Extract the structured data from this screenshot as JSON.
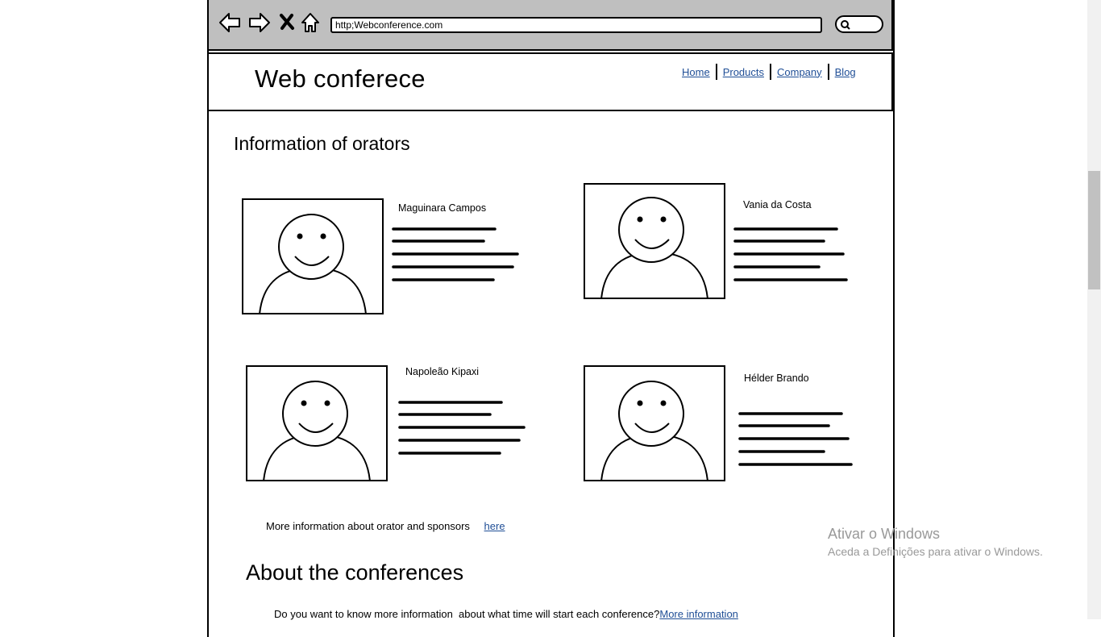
{
  "browser": {
    "url": "http;Webconference.com"
  },
  "site": {
    "title": "Web conferece",
    "nav": [
      "Home",
      "Products",
      "Company",
      "Blog"
    ]
  },
  "orators_section": {
    "title": "Information of orators",
    "orators": [
      {
        "name": "Maguinara Campos"
      },
      {
        "name": "Vania da Costa"
      },
      {
        "name": "Napoleão Kipaxi"
      },
      {
        "name": "Hélder Brando"
      }
    ],
    "more_text": "More information about orator and sponsors",
    "more_link": "here"
  },
  "about_section": {
    "title": "About the conferences",
    "text": "Do you want to know more information  about what time will start each conference?",
    "link": "More information"
  },
  "watermark": {
    "line1": "Ativar o Windows",
    "line2": "Aceda a Definições para ativar o Windows."
  },
  "icons": [
    "back-arrow-icon",
    "forward-arrow-icon",
    "close-x-icon",
    "home-icon",
    "search-icon",
    "person-avatar-icon"
  ]
}
